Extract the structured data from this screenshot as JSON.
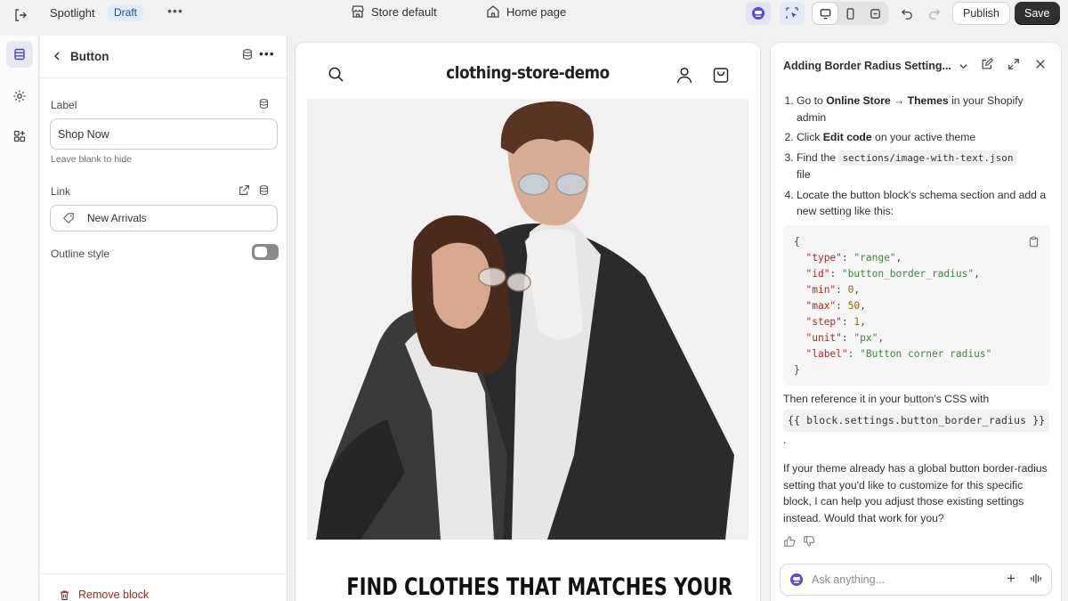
{
  "topbar": {
    "app_name": "Spotlight",
    "status_badge": "Draft",
    "more": "•••",
    "theme_selector": "Store default",
    "page_selector": "Home page",
    "publish_label": "Publish",
    "save_label": "Save"
  },
  "panel": {
    "title": "Button",
    "more": "•••",
    "label_field": {
      "label": "Label",
      "value": "Shop Now",
      "hint": "Leave blank to hide"
    },
    "link_field": {
      "label": "Link",
      "value": "New Arrivals"
    },
    "outline_style": {
      "label": "Outline style",
      "enabled": false
    },
    "remove_label": "Remove block"
  },
  "preview": {
    "store_name": "clothing-store-demo",
    "headline": "FIND CLOTHES THAT MATCHES YOUR"
  },
  "chat": {
    "title": "Adding Border Radius Setting...",
    "steps": {
      "s1_pre": "Go to ",
      "s1_bold": "Online Store → Themes",
      "s1_post": " in your Shopify admin",
      "s2_pre": "Click ",
      "s2_bold": "Edit code",
      "s2_post": " on your active theme",
      "s3_pre": "Find the ",
      "s3_code": "sections/image-with-text.json",
      "s3_post": " file",
      "s4": "Locate the button block's schema section and add a new setting like this:"
    },
    "code": {
      "open": "{",
      "close": "}",
      "type_key": "\"type\"",
      "type_val": "\"range\"",
      "id_key": "\"id\"",
      "id_val": "\"button_border_radius\"",
      "min_key": "\"min\"",
      "min_val": "0",
      "max_key": "\"max\"",
      "max_val": "50",
      "step_key": "\"step\"",
      "step_val": "1",
      "unit_key": "\"unit\"",
      "unit_val": "\"px\"",
      "label_key": "\"label\"",
      "label_val": "\"Button corner radius\""
    },
    "after_text": "Then reference it in your button's CSS with",
    "after_code": "{{ block.settings.button_border_radius }}",
    "after_period": ".",
    "paragraph": "If your theme already has a global button border-radius setting that you'd like to customize for this specific block, I can help you adjust those existing settings instead. Would that work for you?",
    "input_placeholder": "Ask anything..."
  },
  "colors": {
    "accent_ai": "#5c4bd6",
    "save_bg": "#303030",
    "remove_text": "#b42318",
    "draft_badge_bg": "#e0ecfb"
  }
}
